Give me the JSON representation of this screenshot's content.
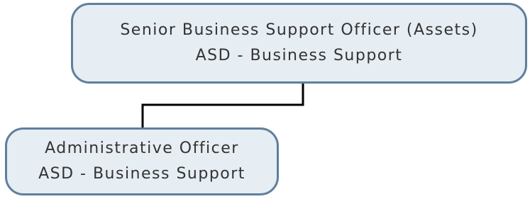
{
  "diagram": {
    "nodes": [
      {
        "title": "Senior Business Support Officer (Assets)",
        "department": "ASD - Business Support"
      },
      {
        "title": "Administrative Officer",
        "department": "ASD - Business Support"
      }
    ],
    "colors": {
      "node_fill": "#e6edf3",
      "node_border": "#5f7f9d",
      "connector": "#000000",
      "text": "#333333"
    }
  }
}
